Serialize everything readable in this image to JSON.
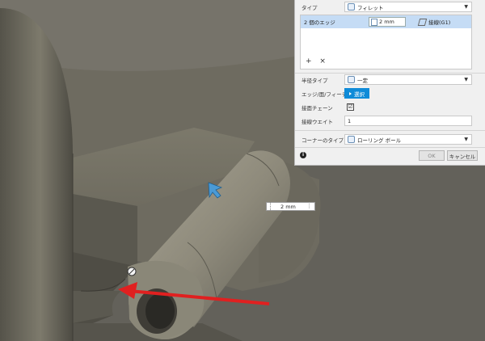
{
  "panel": {
    "type_label": "タイプ",
    "type_value": "フィレット",
    "edges_count": "2 個のエッジ",
    "edges_size": "2 mm",
    "edges_continuity": "接線(G1)",
    "add_icon": "+",
    "remove_icon": "×",
    "radius_type_label": "半径タイプ",
    "radius_type_value": "一定",
    "edge_feature_label": "エッジ/面/フィーチャ",
    "select_button": "選択",
    "tangent_chain_label": "接面チェーン",
    "tangent_chain_check": "☑",
    "tangent_weight_label": "接線ウエイト",
    "tangent_weight_value": "1",
    "corner_type_label": "コーナーのタイプ",
    "corner_type_value": "ローリング ボール",
    "info_icon": "i",
    "ok_button": "OK",
    "cancel_button": "キャンセル"
  },
  "canvas": {
    "dimension_value": "2 mm",
    "dimension_more": "⋮"
  },
  "colors": {
    "model_surface": "#8a8776",
    "selected_blue": "#c5dcf5",
    "select_button": "#0f8bd8",
    "arrow_red": "#e02020"
  }
}
